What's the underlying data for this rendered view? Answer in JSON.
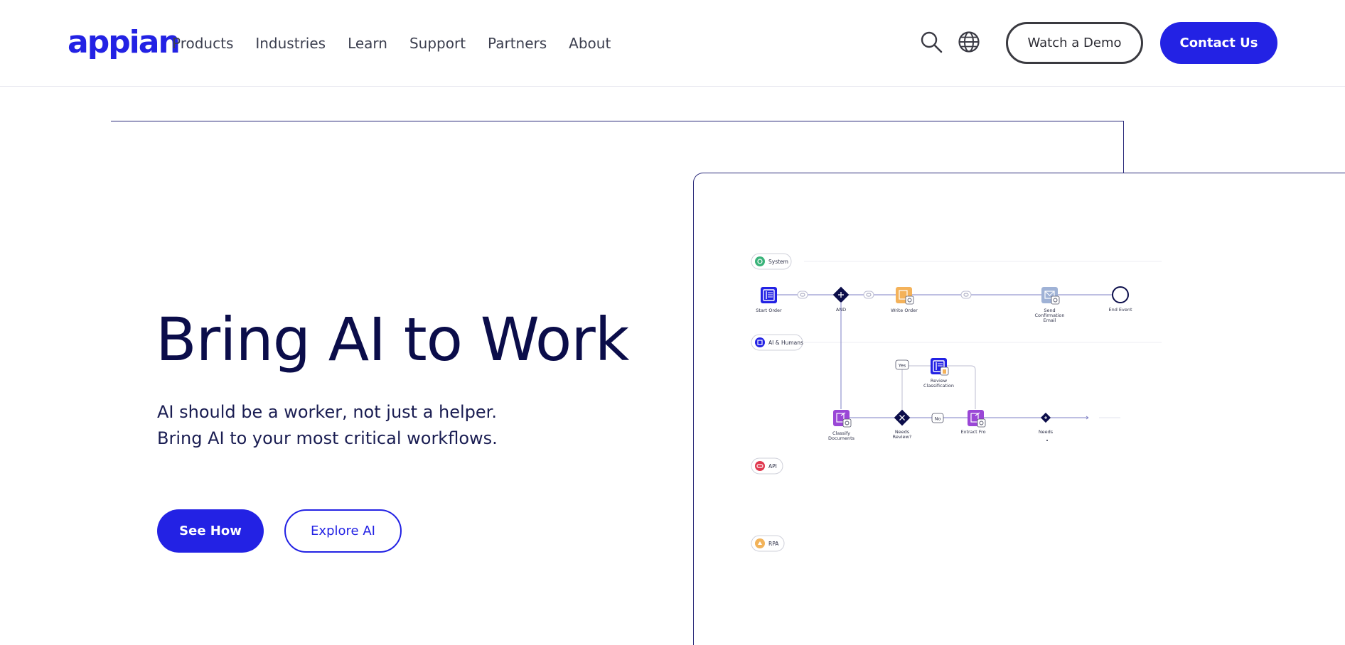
{
  "header": {
    "logo": "appian",
    "nav": [
      "Products",
      "Industries",
      "Learn",
      "Support",
      "Partners",
      "About"
    ],
    "search_icon": "search-icon",
    "globe_icon": "globe-icon",
    "watch_demo": "Watch a Demo",
    "contact_us": "Contact Us"
  },
  "hero": {
    "title": "Bring AI to Work",
    "subtitle_line1": "AI should be a worker, not just a helper.",
    "subtitle_line2": "Bring AI to your most critical workflows.",
    "see_how": "See How",
    "explore_ai": "Explore AI"
  },
  "colors": {
    "brand": "#2322e4",
    "navy": "#0b0d4a",
    "system_lane": "#3ab37a",
    "ai_lane": "#2322e4",
    "api_lane": "#e0394f",
    "rpa_lane": "#f2b35a",
    "task_purple": "#9a47d6",
    "task_orange": "#f4b25a",
    "task_blue_grey": "#9fb2d6"
  },
  "diagram": {
    "lanes": [
      "System",
      "AI & Humans",
      "API",
      "RPA"
    ],
    "nodes": {
      "start_order": "Start Order",
      "and": "AND",
      "write_order": "Write Order",
      "send_email_1": "Send",
      "send_email_2": "Confirmation",
      "send_email_3": "Email",
      "end_event": "End Event",
      "review_1": "Review",
      "review_2": "Classification",
      "classify_1": "Classify",
      "classify_2": "Documents",
      "needs_review_1": "Needs",
      "needs_review_2": "Review?",
      "extract": "Extract Fro",
      "needs": "Needs",
      "yes": "Yes",
      "no": "No"
    }
  }
}
